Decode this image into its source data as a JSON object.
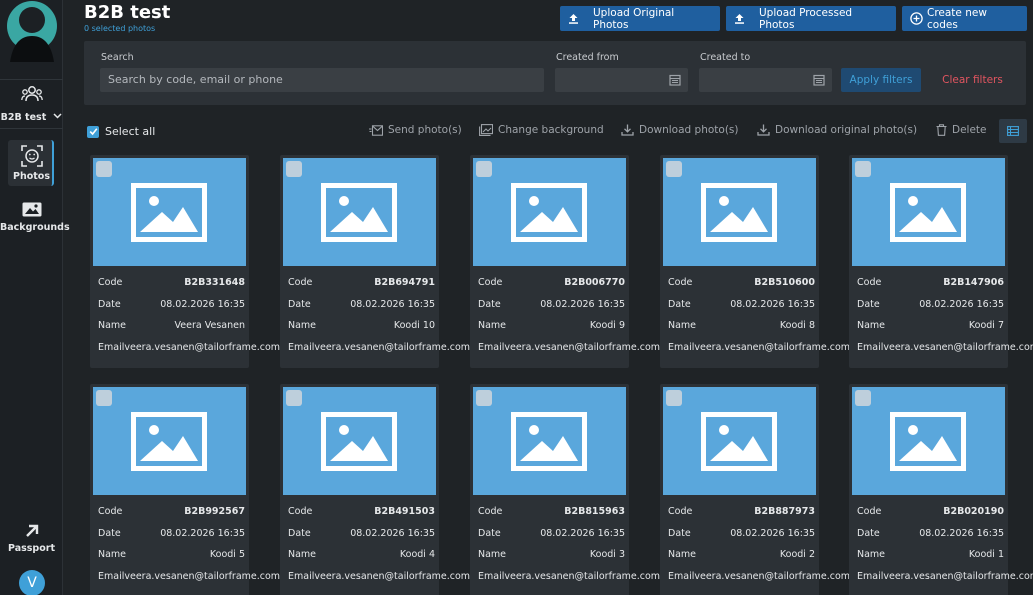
{
  "app": {
    "title": "B2B test",
    "selected_count": "0 selected photos"
  },
  "sidebar": {
    "org_label": "B2B test",
    "items": [
      {
        "label": "Photos"
      },
      {
        "label": "Backgrounds"
      },
      {
        "label": "Passport"
      }
    ],
    "avatar_initial": "V"
  },
  "header_buttons": {
    "upload_original": "Upload Original Photos",
    "upload_processed": "Upload Processed Photos",
    "create_codes": "Create new codes"
  },
  "filters": {
    "search_label": "Search",
    "search_placeholder": "Search by code, email or phone",
    "created_from_label": "Created from",
    "created_to_label": "Created to",
    "apply_label": "Apply filters",
    "clear_label": "Clear filters"
  },
  "toolbar": {
    "select_all": "Select all",
    "send": "Send photo(s)",
    "change_bg": "Change background",
    "download": "Download photo(s)",
    "download_original": "Download original photo(s)",
    "delete": "Delete"
  },
  "field_labels": {
    "code": "Code",
    "date": "Date",
    "name": "Name",
    "email": "Email"
  },
  "cards": [
    {
      "code": "B2B331648",
      "date": "08.02.2026 16:35",
      "name": "Veera Vesanen",
      "email": "veera.vesanen@tailorframe.com"
    },
    {
      "code": "B2B694791",
      "date": "08.02.2026 16:35",
      "name": "Koodi 10",
      "email": "veera.vesanen@tailorframe.com"
    },
    {
      "code": "B2B006770",
      "date": "08.02.2026 16:35",
      "name": "Koodi 9",
      "email": "veera.vesanen@tailorframe.com"
    },
    {
      "code": "B2B510600",
      "date": "08.02.2026 16:35",
      "name": "Koodi 8",
      "email": "veera.vesanen@tailorframe.com"
    },
    {
      "code": "B2B147906",
      "date": "08.02.2026 16:35",
      "name": "Koodi 7",
      "email": "veera.vesanen@tailorframe.com"
    },
    {
      "code": "B2B992567",
      "date": "08.02.2026 16:35",
      "name": "Koodi 5",
      "email": "veera.vesanen@tailorframe.com"
    },
    {
      "code": "B2B491503",
      "date": "08.02.2026 16:35",
      "name": "Koodi 4",
      "email": "veera.vesanen@tailorframe.com"
    },
    {
      "code": "B2B815963",
      "date": "08.02.2026 16:35",
      "name": "Koodi 3",
      "email": "veera.vesanen@tailorframe.com"
    },
    {
      "code": "B2B887973",
      "date": "08.02.2026 16:35",
      "name": "Koodi 2",
      "email": "veera.vesanen@tailorframe.com"
    },
    {
      "code": "B2B020190",
      "date": "08.02.2026 16:35",
      "name": "Koodi 1",
      "email": "veera.vesanen@tailorframe.com"
    }
  ],
  "colors": {
    "accent": "#3fa0d8",
    "primary_button": "#1f5f9f",
    "danger": "#e25560",
    "placeholder_image": "#5aa7dc"
  }
}
